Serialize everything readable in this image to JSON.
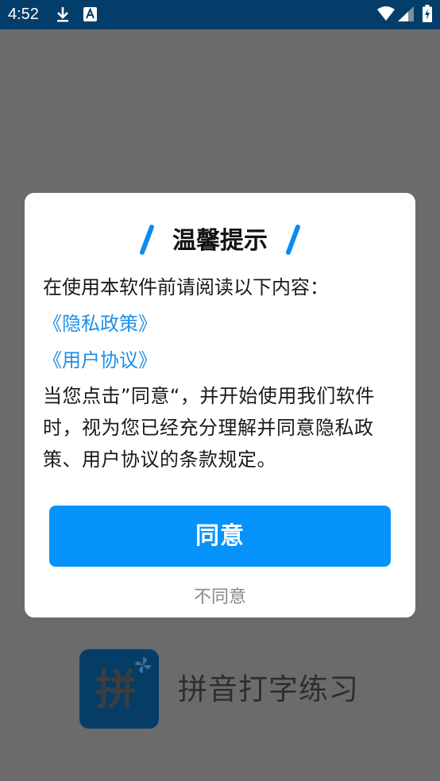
{
  "status_bar": {
    "time": "4:52",
    "icons": [
      "download-icon",
      "keyboard-a-icon",
      "wifi-icon",
      "signal-icon",
      "battery-icon"
    ]
  },
  "splash": {
    "logo_glyph": "拼",
    "app_name": "拼音打字练习"
  },
  "dialog": {
    "title": "温馨提示",
    "intro": "在使用本软件前请阅读以下内容：",
    "privacy_link": "《隐私政策》",
    "user_agreement_link": "《用户协议》",
    "terms_text": "当您点击”同意“，并开始使用我们软件时，视为您已经充分理解并同意隐私政策、用户协议的条款规定。",
    "agree_label": "同意",
    "disagree_label": "不同意"
  },
  "colors": {
    "accent": "#0593fb",
    "link": "#1e8fe8",
    "status_bar": "#033e6b",
    "scrim": "#6b6b6b"
  }
}
